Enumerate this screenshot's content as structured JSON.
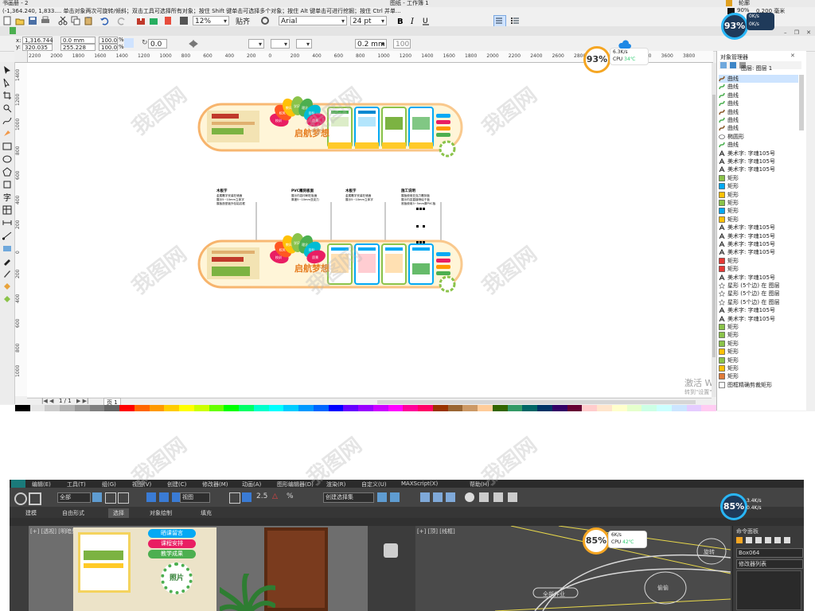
{
  "coreldraw": {
    "title": "书画册 - 2",
    "title_right": "图纸 - 工作簿 1",
    "status_hint": "(-1,364.240, 1,833....  单击对象两次可旋转/倾斜；双击工具可选择所有对象；按住 Shift 键单击可选择多个对象；按住 Alt 键单击可进行挖掘；按住 Ctrl 并单...",
    "outline_label": "轮廓",
    "fill_pct": "90%",
    "outline_width": "0.200 毫米",
    "zoom": "12%",
    "snap_label": "贴齐",
    "font_name": "Arial",
    "font_size": "24 pt",
    "prop_x": "1,316.744 mm",
    "prop_y": "320.035 mm",
    "prop_w": "0.0 mm",
    "prop_h": "255.228 mm",
    "scale_x": "100.0",
    "scale_y": "100.0",
    "pct": "%",
    "angle": "0.0",
    "line_width": "0.2 mm",
    "opacity": "100",
    "page_nav": "1 / 1",
    "page_tab": "页 1",
    "ruler_labels": [
      "2200",
      "2000",
      "1800",
      "1600",
      "1400",
      "1200",
      "1000",
      "800",
      "600",
      "400",
      "200",
      "0",
      "200",
      "400",
      "600",
      "800",
      "1000",
      "1200",
      "1400",
      "1600",
      "1800",
      "2000",
      "2200",
      "2400",
      "2600",
      "2800",
      "3000",
      "3200",
      "3400",
      "3600",
      "3800"
    ],
    "ruler_v_labels": [
      "1400",
      "1200",
      "1000",
      "800",
      "600",
      "400",
      "200",
      "0",
      "200",
      "400",
      "600",
      "800",
      "1000"
    ],
    "win_activate": "激活 Windows",
    "win_activate_sub": "转到\"设置\"以激活 Windows。",
    "palette": [
      "#ffffff",
      "#000000",
      "#e6e6e6",
      "#cccccc",
      "#b3b3b3",
      "#999999",
      "#808080",
      "#666666",
      "#ff0000",
      "#ff6600",
      "#ff9900",
      "#ffcc00",
      "#ffff00",
      "#ccff00",
      "#66ff00",
      "#00ff00",
      "#00ff66",
      "#00ffcc",
      "#00ffff",
      "#00ccff",
      "#0099ff",
      "#0066ff",
      "#0000ff",
      "#6600ff",
      "#9900ff",
      "#cc00ff",
      "#ff00ff",
      "#ff0099",
      "#ff0066",
      "#993300",
      "#996633",
      "#cc9966",
      "#ffcc99",
      "#336600",
      "#339966",
      "#006666",
      "#003366",
      "#330066",
      "#660033",
      "#ffcccc",
      "#ffe5cc",
      "#ffffcc",
      "#e5ffcc",
      "#ccffe5",
      "#ccffff",
      "#cce5ff",
      "#e5ccff",
      "#ffccf2"
    ]
  },
  "object_manager": {
    "title": "对象管理器",
    "layer": "图层: 图层 1",
    "items": [
      {
        "label": "曲线",
        "icon": "curve-icon",
        "color": "#8b5a2b",
        "selected": true
      },
      {
        "label": "曲线",
        "icon": "curve-icon",
        "color": "#4caf50"
      },
      {
        "label": "曲线",
        "icon": "curve-icon",
        "color": "#4caf50"
      },
      {
        "label": "曲线",
        "icon": "curve-icon",
        "color": "#4caf50"
      },
      {
        "label": "曲线",
        "icon": "curve-icon",
        "color": "#8b5a2b"
      },
      {
        "label": "曲线",
        "icon": "curve-icon",
        "color": "#4caf50"
      },
      {
        "label": "曲线",
        "icon": "curve-icon",
        "color": "#8b5a2b"
      },
      {
        "label": "椭圆形",
        "icon": "ellipse-icon",
        "color": "#ffffff"
      },
      {
        "label": "曲线",
        "icon": "curve-icon",
        "color": "#4caf50"
      },
      {
        "label": "美术字: 字魂105号",
        "icon": "text-icon",
        "color": "#333333"
      },
      {
        "label": "美术字: 字魂105号",
        "icon": "text-icon",
        "color": "#333333"
      },
      {
        "label": "美术字: 字魂105号",
        "icon": "text-icon",
        "color": "#333333"
      },
      {
        "label": "矩形",
        "icon": "rect-icon",
        "color": "#8bc34a"
      },
      {
        "label": "矩形",
        "icon": "rect-icon",
        "color": "#03a9f4"
      },
      {
        "label": "矩形",
        "icon": "rect-icon",
        "color": "#ffc107"
      },
      {
        "label": "矩形",
        "icon": "rect-icon",
        "color": "#8bc34a"
      },
      {
        "label": "矩形",
        "icon": "rect-icon",
        "color": "#03a9f4"
      },
      {
        "label": "矩形",
        "icon": "rect-icon",
        "color": "#ffc107"
      },
      {
        "label": "美术字: 字魂105号",
        "icon": "text-icon",
        "color": "#333333"
      },
      {
        "label": "美术字: 字魂105号",
        "icon": "text-icon",
        "color": "#333333"
      },
      {
        "label": "美术字: 字魂105号",
        "icon": "text-icon",
        "color": "#333333"
      },
      {
        "label": "美术字: 字魂105号",
        "icon": "text-icon",
        "color": "#333333"
      },
      {
        "label": "矩形",
        "icon": "rect-icon",
        "color": "#e53935"
      },
      {
        "label": "矩形",
        "icon": "rect-icon",
        "color": "#e53935"
      },
      {
        "label": "美术字: 字魂105号",
        "icon": "text-icon",
        "color": "#333333"
      },
      {
        "label": "星形 (5个边) 在 图层",
        "icon": "star-icon",
        "color": "#ffffff"
      },
      {
        "label": "星形 (5个边) 在 图层",
        "icon": "star-icon",
        "color": "#ffffff"
      },
      {
        "label": "星形 (5个边) 在 图层",
        "icon": "star-icon",
        "color": "#ffffff"
      },
      {
        "label": "美术字: 字魂105号",
        "icon": "text-icon",
        "color": "#333333"
      },
      {
        "label": "美术字: 字魂105号",
        "icon": "text-icon",
        "color": "#333333"
      },
      {
        "label": "矩形",
        "icon": "rect-icon",
        "color": "#8bc34a"
      },
      {
        "label": "矩形",
        "icon": "rect-icon",
        "color": "#8bc34a"
      },
      {
        "label": "矩形",
        "icon": "rect-icon",
        "color": "#8bc34a"
      },
      {
        "label": "矩形",
        "icon": "rect-icon",
        "color": "#ffc107"
      },
      {
        "label": "矩形",
        "icon": "rect-icon",
        "color": "#8bc34a"
      },
      {
        "label": "矩形",
        "icon": "rect-icon",
        "color": "#ffc107"
      },
      {
        "label": "矩形",
        "icon": "rect-icon",
        "color": "#e07b39"
      },
      {
        "label": "图框精确剪裁矩形",
        "icon": "powerclip-icon",
        "color": "#ffffff"
      }
    ]
  },
  "design": {
    "title_text": "启航梦想",
    "petals": [
      {
        "color": "#e91e63",
        "label": "校训"
      },
      {
        "color": "#ff5722",
        "label": "校风"
      },
      {
        "color": "#ffc107",
        "label": "教风"
      },
      {
        "color": "#8bc34a",
        "label": "学风"
      },
      {
        "color": "#4caf50",
        "label": "理念"
      },
      {
        "color": "#00bcd4",
        "label": "目标"
      },
      {
        "color": "#e91e63",
        "label": "愿景"
      }
    ],
    "annotations": [
      {
        "title": "木板字",
        "lines": [
          "金属雕字安装在墙面",
          "展示5~10mm立体字",
          "展板造型板外包铝边框"
        ]
      },
      {
        "title": "PVC雕刻板面",
        "lines": [
          "展示内容印刷在板面",
          "厚度5~10mm亚克力"
        ]
      },
      {
        "title": "木板字",
        "lines": [
          "金属雕字安装在墙面",
          "展示5~10mm立体字"
        ]
      },
      {
        "title": "施工说明",
        "lines": [
          "展板使用亚克力雕刻板",
          "展示内容直接喷绘于板",
          "底板使用3~5mm厚PVC板"
        ]
      }
    ]
  },
  "monitor": {
    "cpu_label": "CPU",
    "top": {
      "pct": "93%",
      "up": "0K/s",
      "down": "0K/s"
    },
    "mid": {
      "pct": "93%",
      "speed": "6.3K/s",
      "cpu": "34℃"
    },
    "max_top": {
      "pct": "85%",
      "up": "3.4K/s",
      "down": "0.4K/s"
    },
    "max_mid": {
      "pct": "85%",
      "speed": "6K/s",
      "cpu": "42℃"
    }
  },
  "max": {
    "menu": [
      "编辑(E)",
      "工具(T)",
      "组(G)",
      "视图(V)",
      "创建(C)",
      "修改器(M)",
      "动画(A)",
      "图形编辑器(D)",
      "渲染(R)",
      "自定义(U)",
      "MAXScript(X)",
      "帮助(H)"
    ],
    "filter_value": "全部",
    "view_value": "视图",
    "selset_value": "创建选择集",
    "ribbon_tabs": [
      "建模",
      "自由形式",
      "选择",
      "对象绘制",
      "填充"
    ],
    "vp_left_label": "[+] [透视] [明暗处理]",
    "vp_right_label": "[+] [顶] [线框]",
    "scene_labels": [
      "晒课留言",
      "课程安排",
      "教学成果",
      "照片"
    ],
    "scene_right": [
      "旋转",
      "偷偷",
      "全部作业"
    ],
    "cmd_title": "命令面板",
    "cmd_object": "Box064",
    "cmd_list": "修改器列表"
  },
  "watermark": "我图网"
}
